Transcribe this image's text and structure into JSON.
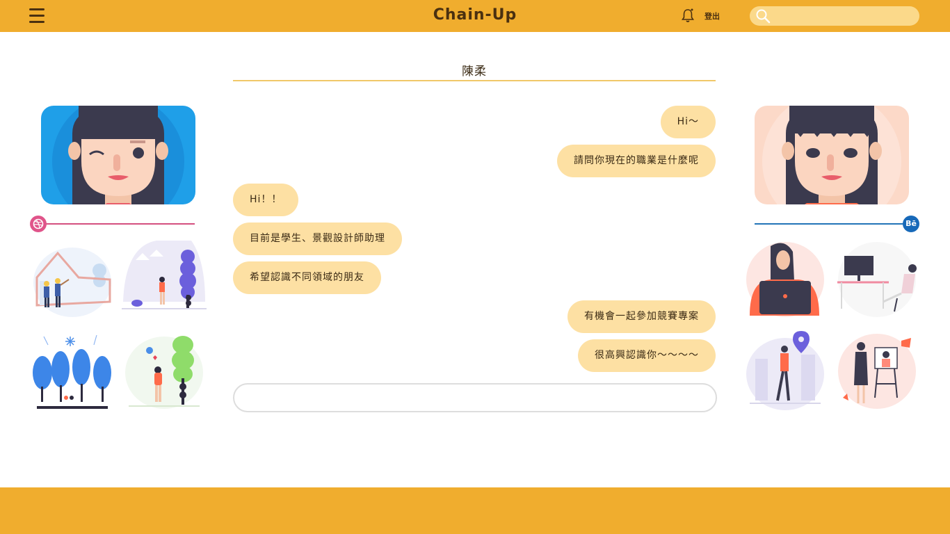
{
  "app": {
    "title": "Chain-Up"
  },
  "header": {
    "logout_label": "登出",
    "search_placeholder": ""
  },
  "chat": {
    "contact_name": "陳柔",
    "messages": [
      {
        "side": "right",
        "text": "Hi～"
      },
      {
        "side": "right",
        "text": "請問你現在的職業是什麼呢"
      },
      {
        "side": "left",
        "text": "Hi！！"
      },
      {
        "side": "left",
        "text": "目前是學生、景觀設計師助理"
      },
      {
        "side": "left",
        "text": "希望認識不同領域的朋友"
      },
      {
        "side": "right",
        "text": "有機會一起參加競賽專案"
      },
      {
        "side": "right",
        "text": "很高興認識你～～～～"
      }
    ],
    "input_value": ""
  },
  "left_profile": {
    "social_label": "dribbble"
  },
  "right_profile": {
    "social_label": "Bē"
  },
  "colors": {
    "brand": "#f0ad2e",
    "bubble": "#fde0a3",
    "dribbble": "#e0548a",
    "behance": "#1769b9"
  }
}
